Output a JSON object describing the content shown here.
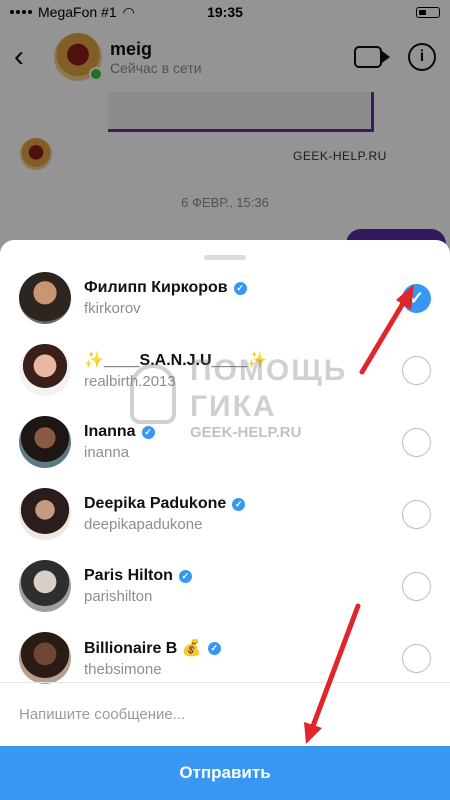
{
  "status_bar": {
    "carrier": "MegaFon #1",
    "time": "19:35"
  },
  "chat_header": {
    "name": "meig",
    "status": "Сейчас в сети"
  },
  "chat_background": {
    "site_label": "GEEK-HELP.RU",
    "date_divider": "6 ФЕВР., 15:36"
  },
  "share_sheet": {
    "recipients": [
      {
        "name": "Филипп Киркоров",
        "handle": "fkirkorov",
        "verified": true,
        "selected": true
      },
      {
        "name": "✨____S.A.N.J.U____✨",
        "handle": "realbirth.2013",
        "verified": false,
        "selected": false
      },
      {
        "name": "Inanna",
        "handle": "inanna",
        "verified": true,
        "selected": false
      },
      {
        "name": "Deepika Padukone",
        "handle": "deepikapadukone",
        "verified": true,
        "selected": false
      },
      {
        "name": "Paris Hilton",
        "handle": "parishilton",
        "verified": true,
        "selected": false
      },
      {
        "name": "Billionaire B 💰",
        "handle": "thebsimone",
        "verified": true,
        "selected": false
      }
    ],
    "message_placeholder": "Напишите сообщение...",
    "send_label": "Отправить"
  },
  "watermark": {
    "line1": "ПОМОЩЬ",
    "line2": "ГИКА",
    "line3": "GEEK-HELP.RU"
  },
  "colors": {
    "accent": "#3897f0",
    "annotation_arrow": "#e0252b"
  }
}
